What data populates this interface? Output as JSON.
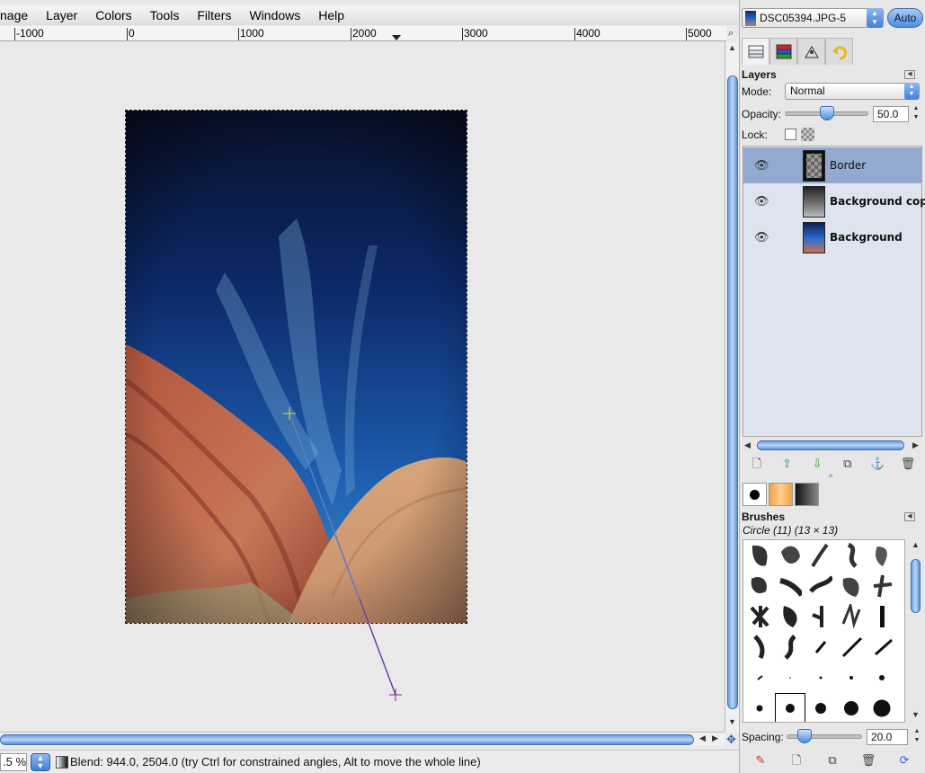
{
  "menubar": {
    "items": [
      "nage",
      "Layer",
      "Colors",
      "Tools",
      "Filters",
      "Windows",
      "Help"
    ]
  },
  "ruler": {
    "labels": [
      "-1000",
      "0",
      "1000",
      "2000",
      "3000",
      "4000",
      "5000"
    ]
  },
  "statusbar": {
    "zoom": ".5 %",
    "message": "Blend: 944.0, 2504.0 (try Ctrl for constrained angles, Alt to move the whole line)"
  },
  "dock": {
    "image_name": "DSC05394.JPG-5",
    "auto_label": "Auto",
    "tab_icons": [
      "layers-tab-icon",
      "channels-tab-icon",
      "paths-tab-icon",
      "undo-tab-icon"
    ]
  },
  "layers": {
    "title": "Layers",
    "mode_label": "Mode:",
    "mode_value": "Normal",
    "opacity_label": "Opacity:",
    "opacity_value": "50.0",
    "opacity_fraction": 0.5,
    "lock_label": "Lock:",
    "items": [
      {
        "name": "Border",
        "selected": true,
        "visible": true
      },
      {
        "name": "Background copy",
        "selected": false,
        "visible": true
      },
      {
        "name": "Background",
        "selected": false,
        "visible": true
      }
    ]
  },
  "brushes": {
    "title": "Brushes",
    "current": "Circle (11) (13 × 13)",
    "spacing_label": "Spacing:",
    "spacing_value": "20.0"
  },
  "colors": {
    "accent": "#4f8ee0",
    "selection": "#93a9cf",
    "blend_line_start": "#5a7fc0",
    "blend_line_end": "#7a2a8a"
  }
}
